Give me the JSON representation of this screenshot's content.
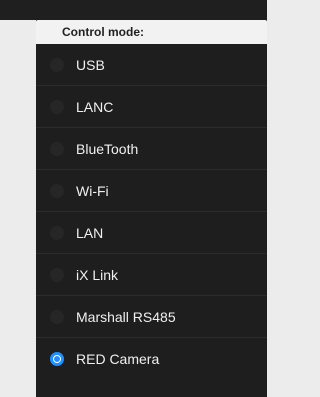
{
  "control_mode": {
    "title": "Control mode:",
    "options": [
      {
        "label": "USB",
        "selected": false
      },
      {
        "label": "LANC",
        "selected": false
      },
      {
        "label": "BlueTooth",
        "selected": false
      },
      {
        "label": "Wi-Fi",
        "selected": false
      },
      {
        "label": "LAN",
        "selected": false
      },
      {
        "label": "iX Link",
        "selected": false
      },
      {
        "label": "Marshall RS485",
        "selected": false
      },
      {
        "label": "RED Camera",
        "selected": true
      }
    ],
    "accent_color": "#1e90ff"
  }
}
